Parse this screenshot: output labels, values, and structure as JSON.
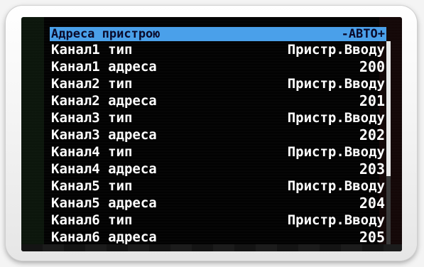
{
  "header": {
    "title": "Адреса пристрою",
    "mode": "-АВТО+"
  },
  "rows": [
    {
      "label": "Канал1 тип",
      "value": "Пристр.Вводу"
    },
    {
      "label": "Канал1 адреса",
      "value": "200"
    },
    {
      "label": "Канал2 тип",
      "value": "Пристр.Вводу"
    },
    {
      "label": "Канал2 адреса",
      "value": "201"
    },
    {
      "label": "Канал3 тип",
      "value": "Пристр.Вводу"
    },
    {
      "label": "Канал3 адреса",
      "value": "202"
    },
    {
      "label": "Канал4 тип",
      "value": "Пристр.Вводу"
    },
    {
      "label": "Канал4 адреса",
      "value": "203"
    },
    {
      "label": "Канал5 тип",
      "value": "Пристр.Вводу"
    },
    {
      "label": "Канал5 адреса",
      "value": "204"
    },
    {
      "label": "Канал6 тип",
      "value": "Пристр.Вводу"
    },
    {
      "label": "Канал6 адреса",
      "value": "205"
    }
  ],
  "colors": {
    "highlight": "#4aa0ea",
    "screen": "#020202",
    "text": "#ffffff"
  }
}
